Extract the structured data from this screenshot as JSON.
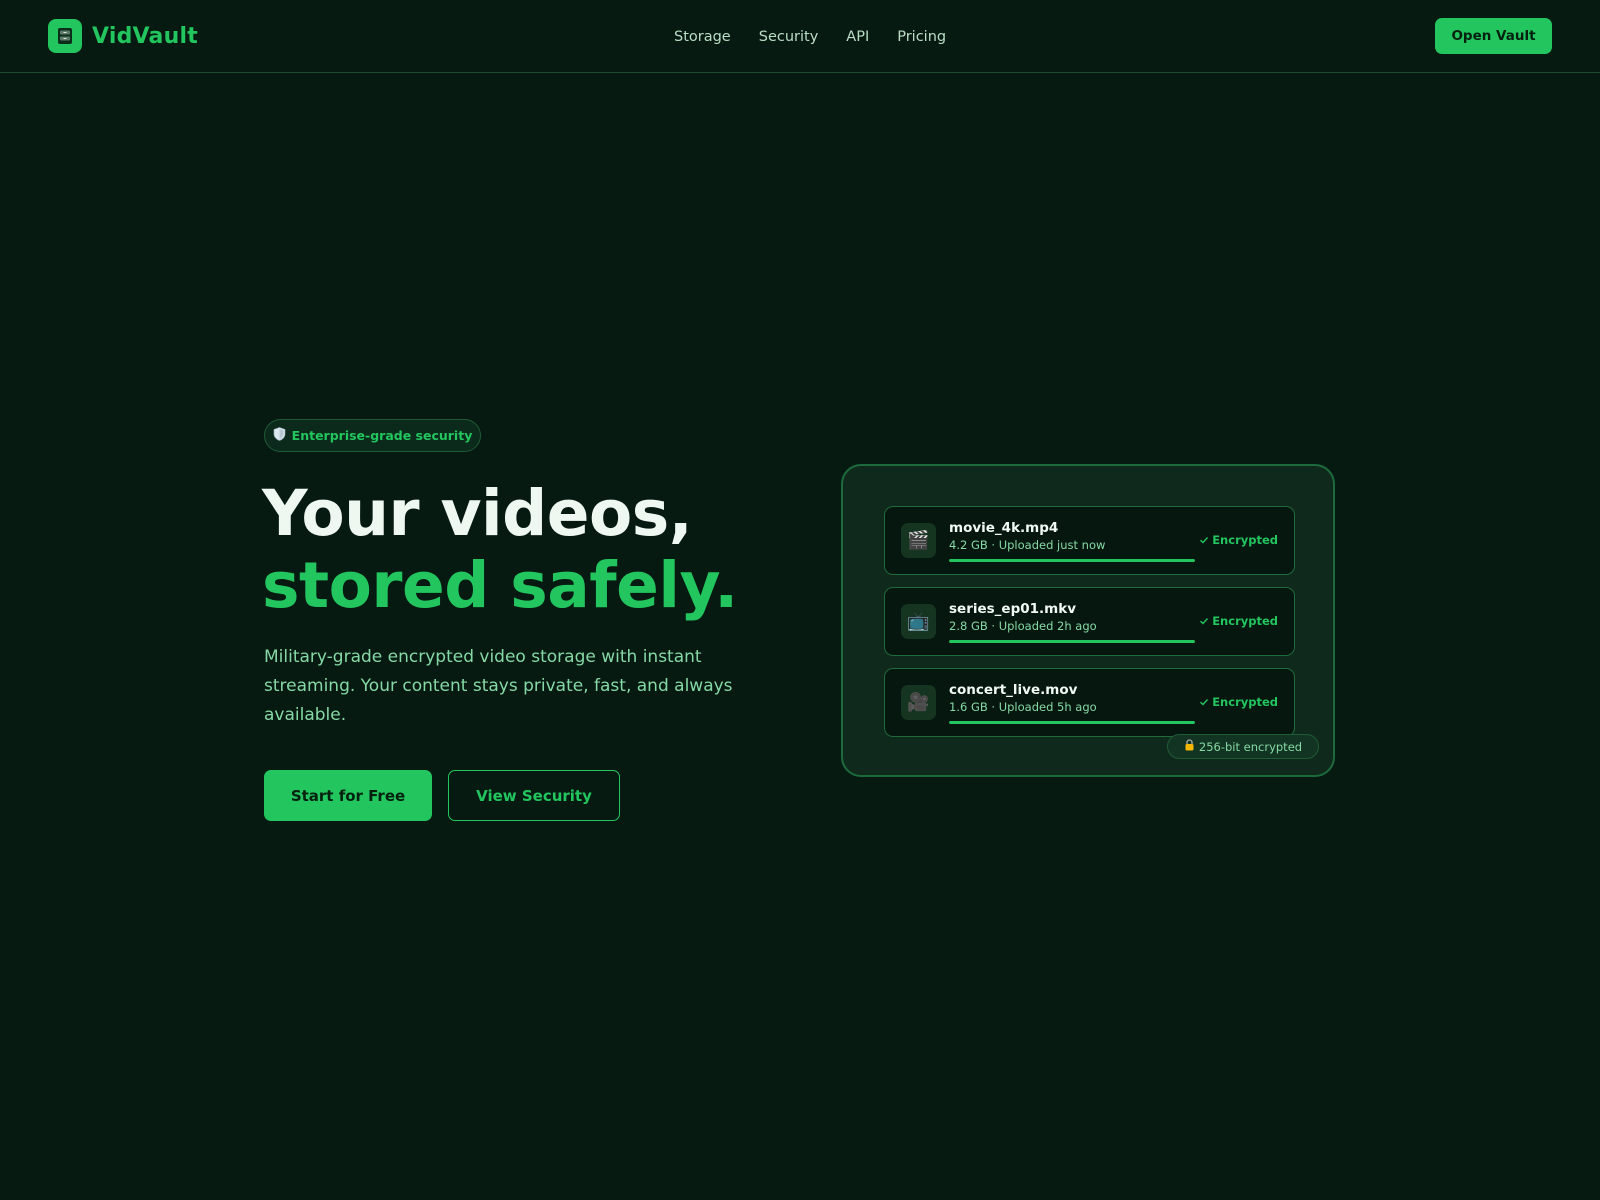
{
  "nav": {
    "brand": "VidVault",
    "links": [
      "Storage",
      "Security",
      "API",
      "Pricing"
    ],
    "cta_label": "Open Vault"
  },
  "hero": {
    "badge_label": "Enterprise-grade security",
    "title_line1": "Your videos,",
    "title_line2": "stored safely.",
    "subtitle": "Military-grade encrypted video storage with instant streaming. Your content stays private, fast, and always available.",
    "primary_label": "Start for Free",
    "secondary_label": "View Security"
  },
  "vault": {
    "files": [
      {
        "icon": "🎬",
        "icon_name": "clapper-icon",
        "name": "movie_4k.mp4",
        "meta": "4.2 GB · Uploaded just now",
        "status": "Encrypted",
        "progress": 1.0
      },
      {
        "icon": "📺",
        "icon_name": "tv-icon",
        "name": "series_ep01.mkv",
        "meta": "2.8 GB · Uploaded 2h ago",
        "status": "Encrypted",
        "progress": 1.0
      },
      {
        "icon": "🎥",
        "icon_name": "video-camera-icon",
        "name": "concert_live.mov",
        "meta": "1.6 GB · Uploaded 5h ago",
        "status": "Encrypted",
        "progress": 1.0
      }
    ],
    "encryption_label": "256-bit encrypted"
  },
  "colors": {
    "background": "#061a12",
    "accent": "#22c55e",
    "card": "#0f2a1c",
    "text_muted": "#86d9a5"
  }
}
